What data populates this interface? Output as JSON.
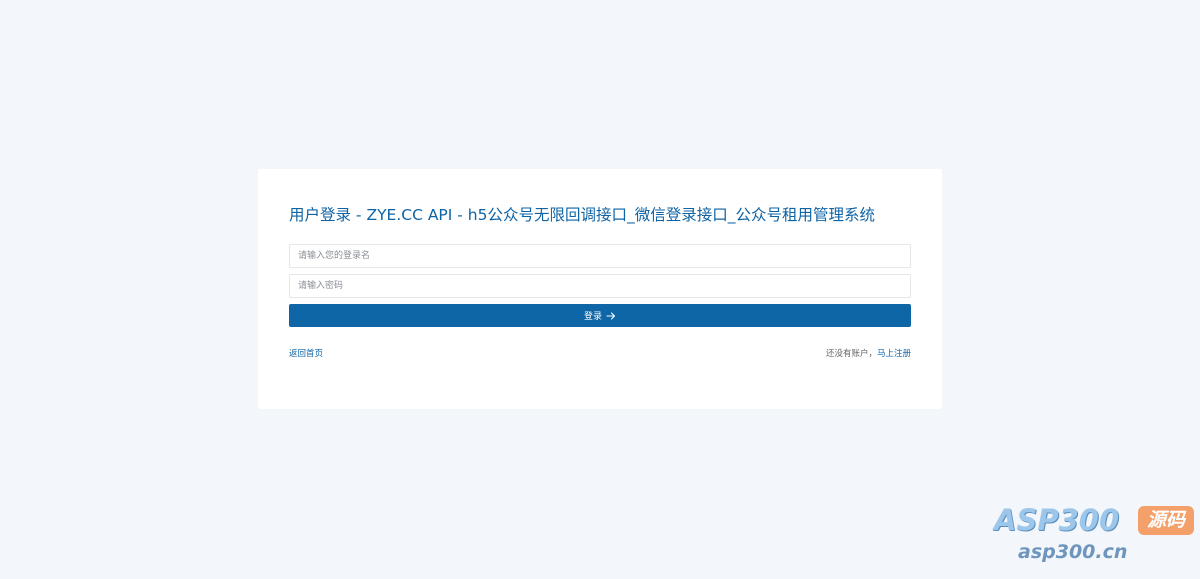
{
  "login": {
    "title": "用户登录 - ZYE.CC API - h5公众号无限回调接口_微信登录接口_公众号租用管理系统",
    "username_placeholder": "请输入您的登录名",
    "username_value": "",
    "password_placeholder": "请输入密码",
    "password_value": "",
    "submit_label": "登录",
    "submit_icon": "arrow-right-icon",
    "back_home_label": "返回首页",
    "no_account_text": "还没有账户，",
    "register_label": "马上注册"
  },
  "watermark": {
    "brand": "ASP300",
    "badge": "源码",
    "url": "asp300.cn"
  },
  "colors": {
    "background": "#f3f6fa",
    "card": "#ffffff",
    "accent": "#0e66a6",
    "title": "#0e63a4"
  }
}
